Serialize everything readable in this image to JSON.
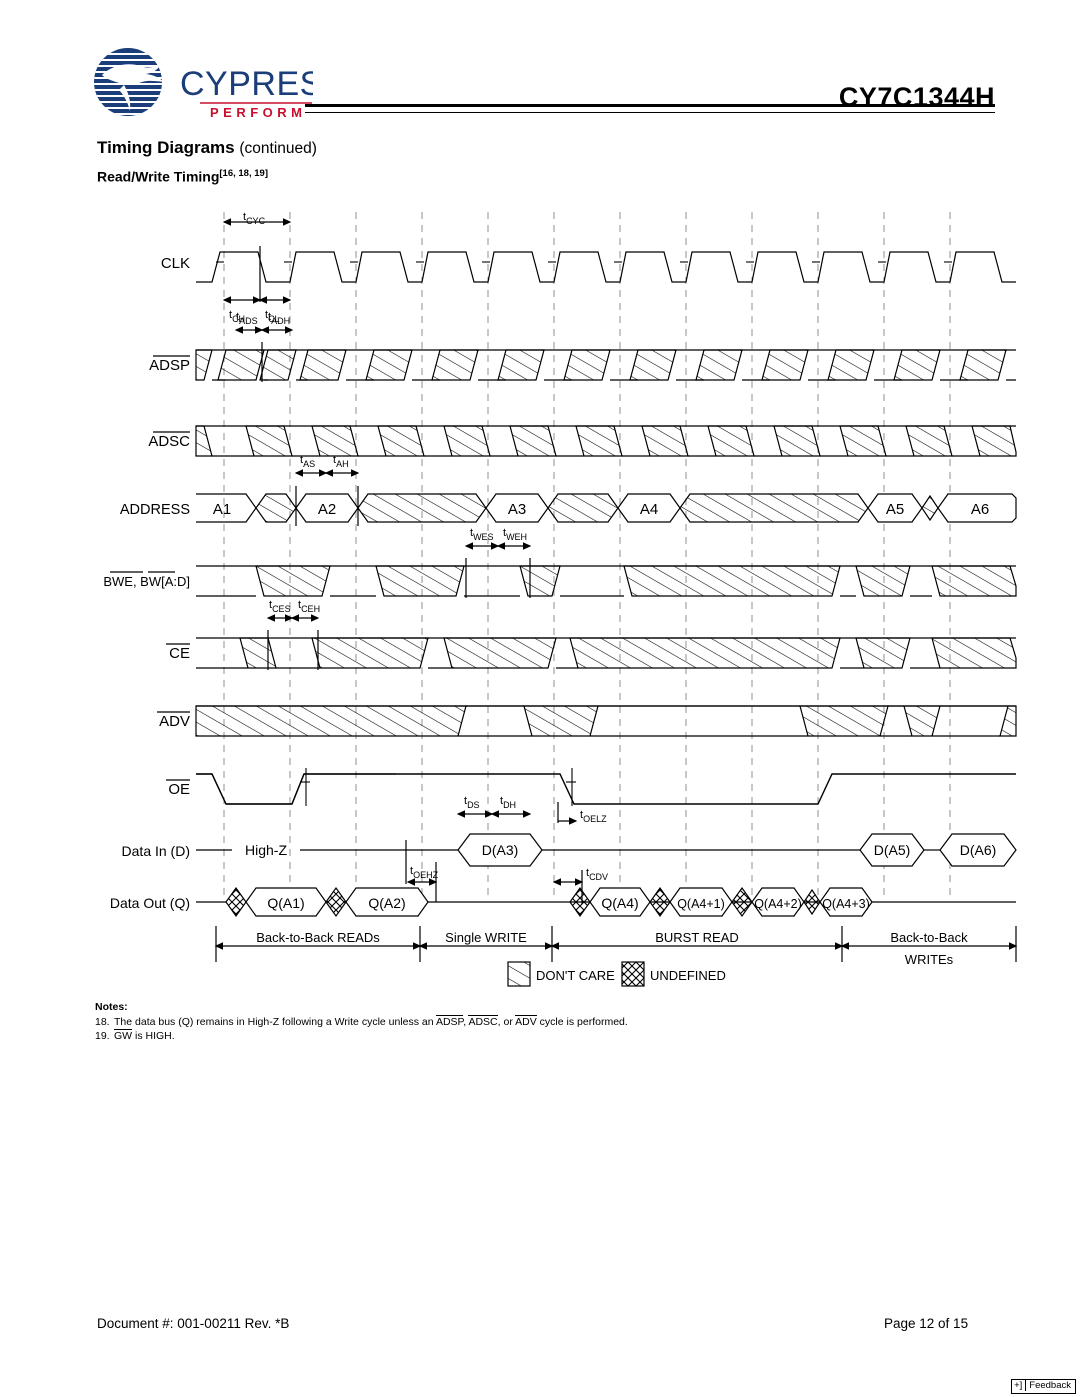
{
  "header": {
    "logo_name": "Cypress",
    "logo_tagline": "PERFORM",
    "part_number": "CY7C1344H",
    "section_title": "Timing Diagrams",
    "section_continued": "(continued)",
    "diagram_title": "Read/Write Timing",
    "diagram_notes_ref": "[16, 18, 19]",
    "logo_blue": "#1b3d7a",
    "logo_red": "#c8102e"
  },
  "diagram": {
    "signals": [
      {
        "label": "CLK",
        "overline": false,
        "type": "clock"
      },
      {
        "label": "ADSP",
        "overline": true,
        "type": "control"
      },
      {
        "label": "ADSC",
        "overline": true,
        "type": "control"
      },
      {
        "label": "ADDRESS",
        "overline": false,
        "type": "bus"
      },
      {
        "label": "BWE, BW[A:D]",
        "overline": true,
        "type": "control"
      },
      {
        "label": "CE",
        "overline": true,
        "type": "control"
      },
      {
        "label": "ADV",
        "overline": true,
        "type": "control"
      },
      {
        "label": "OE",
        "overline": true,
        "type": "enable"
      },
      {
        "label": "Data In (D)",
        "overline": false,
        "type": "data"
      },
      {
        "label": "Data Out (Q)",
        "overline": false,
        "type": "data"
      }
    ],
    "timing_params": [
      {
        "name": "tCYC",
        "base": "t",
        "sub": "CYC"
      },
      {
        "name": "tCH",
        "base": "t",
        "sub": "CH"
      },
      {
        "name": "tCL",
        "base": "t",
        "sub": "CL"
      },
      {
        "name": "tADS",
        "base": "t",
        "sub": "ADS"
      },
      {
        "name": "tADH",
        "base": "t",
        "sub": "ADH"
      },
      {
        "name": "tAS",
        "base": "t",
        "sub": "AS"
      },
      {
        "name": "tAH",
        "base": "t",
        "sub": "AH"
      },
      {
        "name": "tWES",
        "base": "t",
        "sub": "WES"
      },
      {
        "name": "tWEH",
        "base": "t",
        "sub": "WEH"
      },
      {
        "name": "tCES",
        "base": "t",
        "sub": "CES"
      },
      {
        "name": "tCEH",
        "base": "t",
        "sub": "CEH"
      },
      {
        "name": "tDS",
        "base": "t",
        "sub": "DS"
      },
      {
        "name": "tDH",
        "base": "t",
        "sub": "DH"
      },
      {
        "name": "tOELZ",
        "base": "t",
        "sub": "OELZ"
      },
      {
        "name": "tOEHZ",
        "base": "t",
        "sub": "OEHZ"
      },
      {
        "name": "tCDV",
        "base": "t",
        "sub": "CDV"
      }
    ],
    "address_values": [
      "A1",
      "A2",
      "A3",
      "A4",
      "A5",
      "A6"
    ],
    "data_in_values": [
      "D(A3)",
      "D(A5)",
      "D(A6)"
    ],
    "data_in_highz": "High-Z",
    "data_out_values": [
      "Q(A1)",
      "Q(A2)",
      "Q(A4)",
      "Q(A4+1)",
      "Q(A4+2)",
      "Q(A4+3)"
    ],
    "phases": [
      {
        "label": "Back-to-Back READs",
        "label2": ""
      },
      {
        "label": "Single WRITE",
        "label2": ""
      },
      {
        "label": "BURST READ",
        "label2": ""
      },
      {
        "label": "Back-to-Back",
        "label2": "WRITEs"
      }
    ],
    "legend": [
      {
        "pattern": "diagonal",
        "label": "DON'T CARE"
      },
      {
        "pattern": "crosshatch",
        "label": "UNDEFINED"
      }
    ]
  },
  "notes": {
    "heading": "Notes:",
    "items": [
      {
        "num": "18.",
        "pre": "The data bus (Q) remains in High-Z following a Write cycle unless an ",
        "ovl1": "ADSP",
        "mid1": ", ",
        "ovl2": "ADSC",
        "mid2": ", or ",
        "ovl3": "ADV",
        "post": " cycle is performed."
      },
      {
        "num": "19.",
        "pre": "",
        "ovl1": "GW",
        "mid1": "",
        "ovl2": "",
        "mid2": "",
        "ovl3": "",
        "post": " is HIGH."
      }
    ]
  },
  "footer": {
    "document": "Document #: 001-00211 Rev. *B",
    "page": "Page 12 of 15",
    "feedback_plus": "+]",
    "feedback_label": "Feedback"
  }
}
